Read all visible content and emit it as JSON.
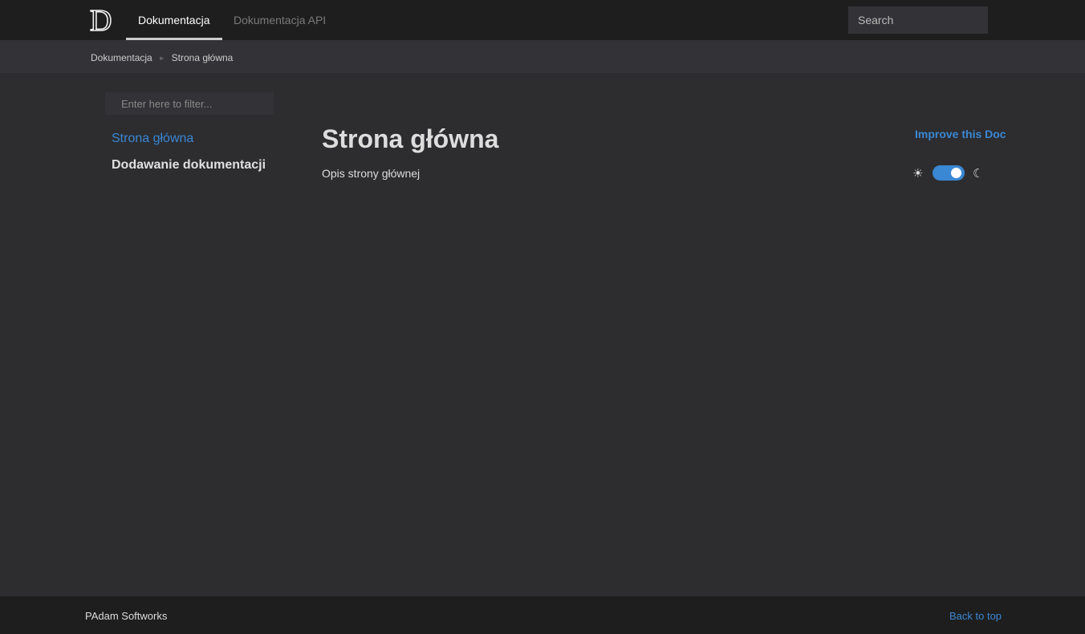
{
  "navbar": {
    "logo_letter": "D",
    "tabs": [
      {
        "label": "Dokumentacja",
        "active": true
      },
      {
        "label": "Dokumentacja API",
        "active": false
      }
    ],
    "search_placeholder": "Search"
  },
  "breadcrumb": {
    "items": [
      "Dokumentacja",
      "Strona główna"
    ],
    "separator": "►"
  },
  "sidebar": {
    "filter_placeholder": "Enter here to filter...",
    "items": [
      {
        "label": "Strona główna",
        "active": true
      },
      {
        "label": "Dodawanie dokumentacji",
        "active": false
      }
    ]
  },
  "main": {
    "title": "Strona główna",
    "description": "Opis strony głównej"
  },
  "affix": {
    "improve_label": "Improve this Doc",
    "sun_icon": "☀",
    "moon_icon": "☾",
    "dark_mode_enabled": true
  },
  "footer": {
    "text": "PAdam Softworks",
    "back_to_top": "Back to top"
  },
  "colors": {
    "accent": "#3a87d4",
    "navbar_bg": "#1e1e1e",
    "body_bg": "#2d2d30",
    "subnav_bg": "#333337"
  }
}
